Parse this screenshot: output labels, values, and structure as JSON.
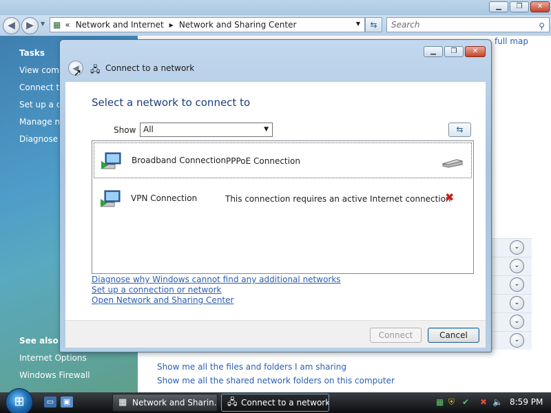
{
  "background_window": {
    "breadcrumb": [
      "Network and Internet",
      "Network and Sharing Center"
    ],
    "breadcrumb_prefix": "«",
    "search_placeholder": "Search",
    "full_map_link": "full map",
    "tasks": {
      "heading": "Tasks",
      "items": [
        "View comp",
        "Connect to",
        "Set up a co",
        "Manage ne",
        "Diagnose a"
      ]
    },
    "see_also": {
      "heading": "See also",
      "items": [
        "Internet Options",
        "Windows Firewall"
      ]
    },
    "sharing_links": [
      "Show me all the files and folders I am sharing",
      "Show me all the shared network folders on this computer"
    ]
  },
  "dialog": {
    "title": "Connect to a network",
    "heading": "Select a network to connect to",
    "show_label": "Show",
    "show_value": "All",
    "networks": [
      {
        "name": "Broadband Connection",
        "description": "PPPoE Connection",
        "status_icon": "modem-icon"
      },
      {
        "name": "VPN Connection",
        "description": "This connection requires an active Internet connection",
        "status_icon": "unavailable-x-icon"
      }
    ],
    "links": [
      "Diagnose why Windows cannot find any additional networks",
      "Set up a connection or network",
      "Open Network and Sharing Center"
    ],
    "connect_label": "Connect",
    "cancel_label": "Cancel"
  },
  "taskbar": {
    "buttons": [
      "Network and Sharin...",
      "Connect to a network"
    ],
    "clock": "8:59 PM"
  },
  "colors": {
    "link": "#2a5db0",
    "heading": "#1e3a78",
    "error_x": "#d11a1a"
  }
}
